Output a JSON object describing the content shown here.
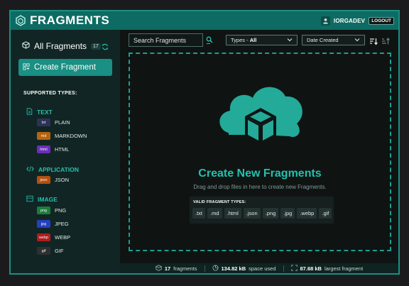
{
  "header": {
    "title": "FRAGMENTS",
    "username": "IORGADEV",
    "logout_label": "LOGOUT"
  },
  "sidebar": {
    "all_label": "All Fragments",
    "count": "17",
    "create_label": "Create Fragment",
    "types_heading": "SUPPORTED TYPES:",
    "groups": [
      {
        "label": "TEXT",
        "types": [
          {
            "chip": "txt",
            "name": "PLAIN",
            "color": "#2b3358"
          },
          {
            "chip": "md",
            "name": "MARKDOWN",
            "color": "#b5640f"
          },
          {
            "chip": "html",
            "name": "HTML",
            "color": "#6a2fb8"
          }
        ]
      },
      {
        "label": "APPLICATION",
        "types": [
          {
            "chip": "json",
            "name": "JSON",
            "color": "#b5500f"
          }
        ]
      },
      {
        "label": "IMAGE",
        "types": [
          {
            "chip": "png",
            "name": "PNG",
            "color": "#1c7d3c"
          },
          {
            "chip": "jpg",
            "name": "JPEG",
            "color": "#243fbf"
          },
          {
            "chip": "webp",
            "name": "WEBP",
            "color": "#b01d1d"
          },
          {
            "chip": "gif",
            "name": "GIF",
            "color": "#2e3030"
          }
        ]
      }
    ]
  },
  "toolbar": {
    "search_placeholder": "Search Fragments",
    "types_label": "Types - ",
    "types_value": "All",
    "date_label": "Date Created"
  },
  "dropzone": {
    "title": "Create New Fragments",
    "subtitle": "Drag and drop files in here to create new Fragments.",
    "valid_heading": "VALID FRAGMENT TYPES:",
    "extensions": [
      ".txt",
      ".md",
      ".html",
      ".json",
      ".png",
      ".jpg",
      ".webp",
      ".gif"
    ]
  },
  "footer": {
    "fragments_value": "17",
    "fragments_label": "fragments",
    "space_value": "134.82 kB",
    "space_label": "space used",
    "largest_value": "87.68 kB",
    "largest_label": "largest fragment"
  },
  "colors": {
    "accent": "#1a8f83",
    "accent_text": "#23c1ad",
    "header_bg": "#0d6b63"
  }
}
